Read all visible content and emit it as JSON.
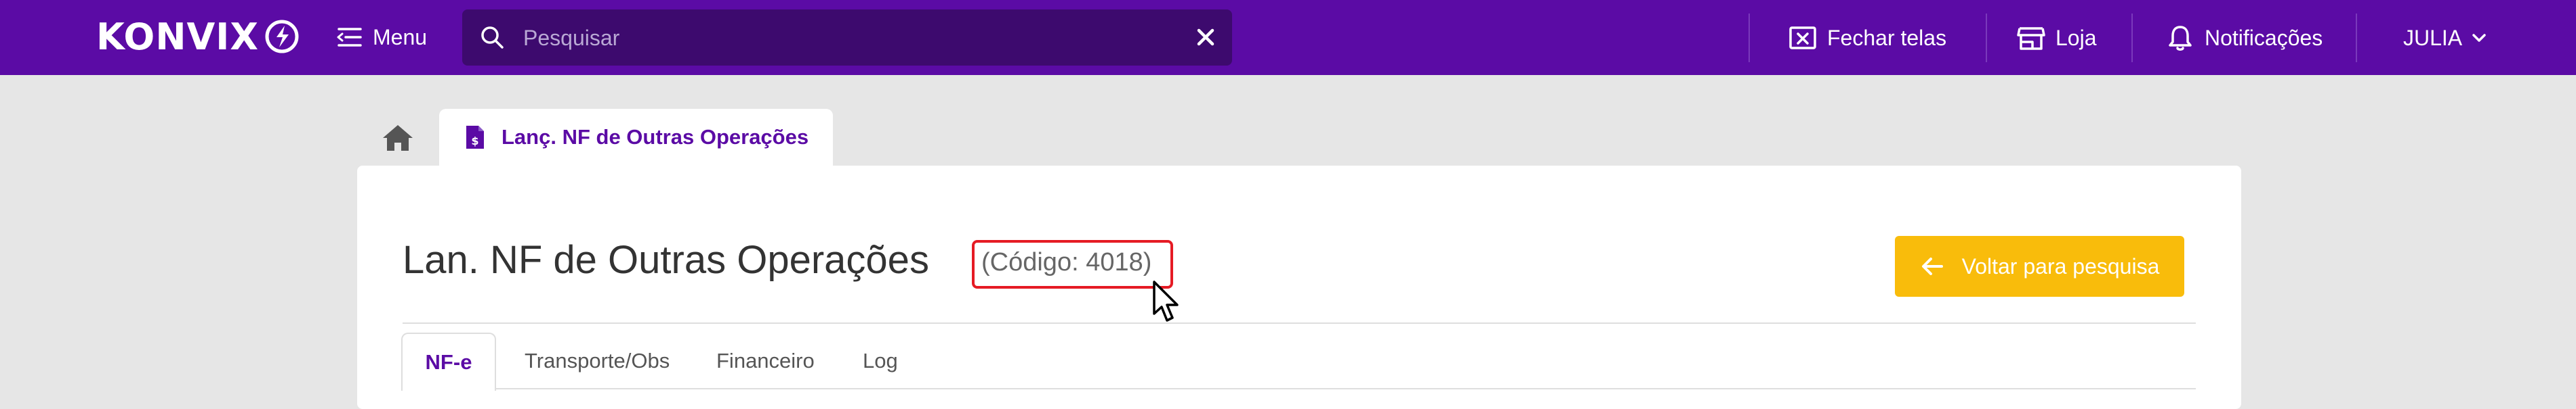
{
  "header": {
    "logo_text": "KONVIX",
    "menu_label": "Menu",
    "search": {
      "placeholder": "Pesquisar",
      "value": ""
    },
    "fechar_telas": "Fechar telas",
    "loja": "Loja",
    "notificacoes": "Notificações",
    "user": "JULIA"
  },
  "tabs": {
    "active_label": "Lanç. NF de Outras Operações"
  },
  "page": {
    "title": "Lan. NF de Outras Operações",
    "code": "(Código: 4018)",
    "back_button": "Voltar para pesquisa"
  },
  "form_tabs": [
    "NF-e",
    "Transporte/Obs",
    "Financeiro",
    "Log"
  ],
  "colors": {
    "brand": "#5b0ba5",
    "search_bg": "#3d0a6e",
    "accent": "#f9bc0b",
    "highlight": "#e51b24",
    "background": "#e6e6e6"
  }
}
